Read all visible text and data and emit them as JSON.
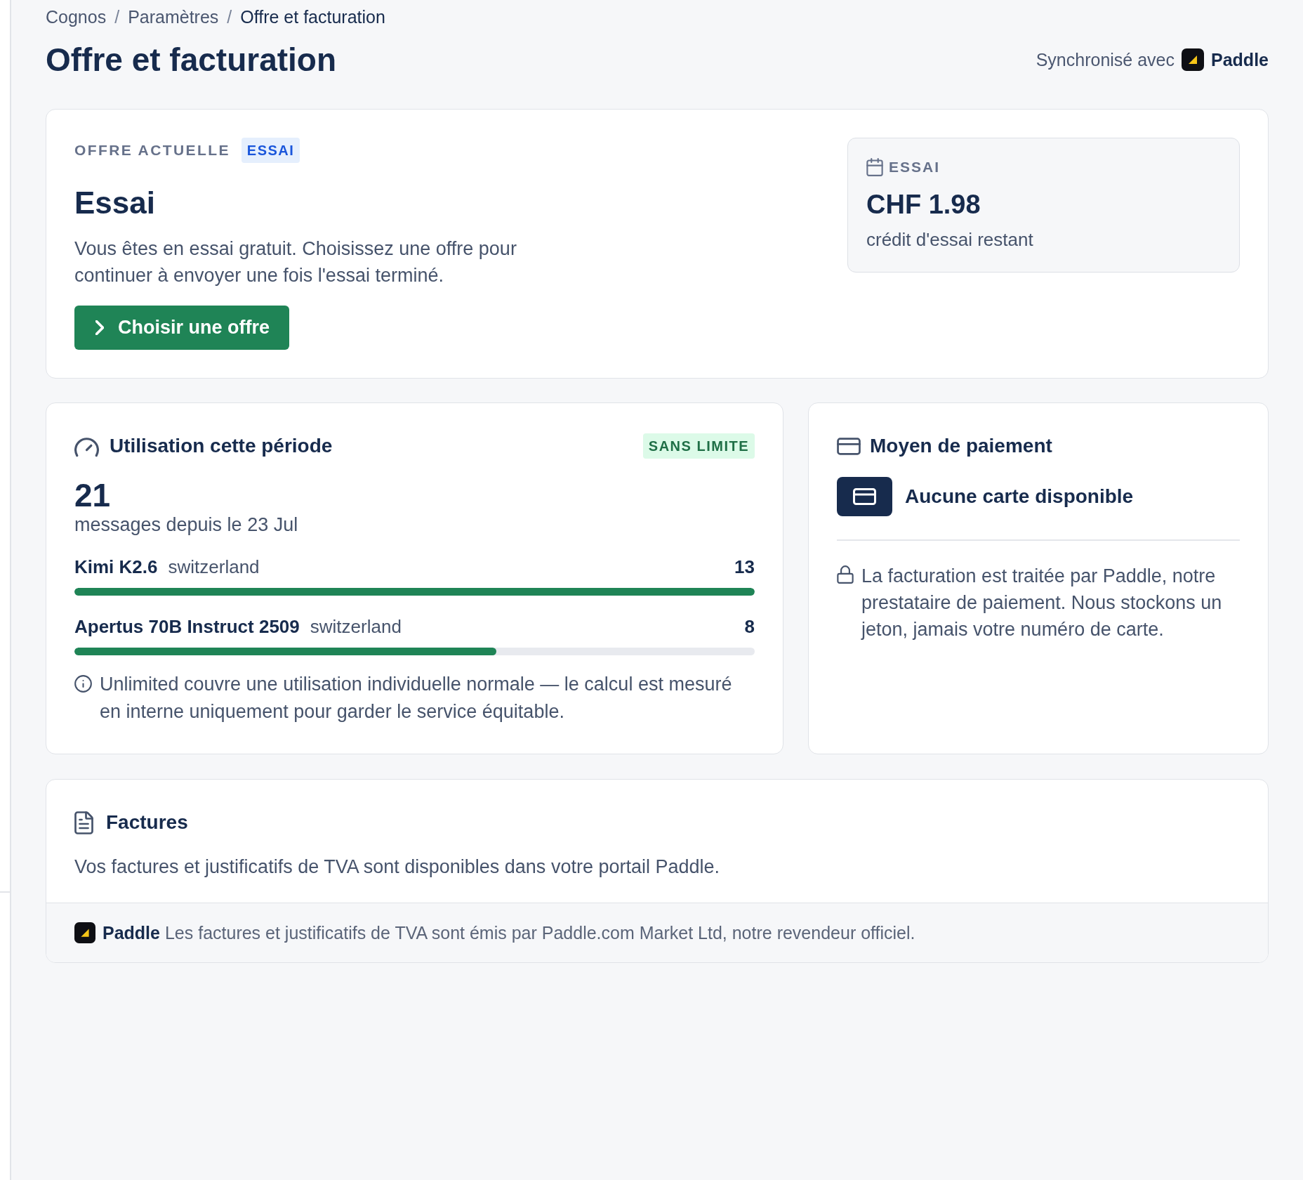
{
  "breadcrumb": {
    "items": [
      {
        "label": "Cognos",
        "current": false
      },
      {
        "label": "Paramètres",
        "current": false
      },
      {
        "label": "Offre et facturation",
        "current": true
      }
    ],
    "separators": [
      "/",
      "/"
    ]
  },
  "page_title": "Offre et facturation",
  "sync": {
    "label": "Synchronisé avec",
    "provider": "Paddle"
  },
  "current_offer": {
    "eyebrow": "OFFRE ACTUELLE",
    "badge": "ESSAI",
    "name": "Essai",
    "description": "Vous êtes en essai gratuit. Choisissez une offre pour continuer à envoyer une fois l'essai terminé.",
    "button": "Choisir une offre",
    "credit": {
      "label": "ESSAI",
      "amount": "CHF 1.98",
      "caption": "crédit d'essai restant"
    }
  },
  "usage": {
    "title": "Utilisation cette période",
    "badge": "SANS LIMITE",
    "count": "21",
    "caption": "messages depuis le 23 Jul",
    "models": [
      {
        "name": "Kimi K2.6",
        "region": "switzerland",
        "count": "13",
        "level": 1
      },
      {
        "name": "Apertus 70B Instruct 2509",
        "region": "switzerland",
        "count": "8",
        "level": 0.62
      }
    ],
    "note": "Unlimited couvre une utilisation individuelle normale — le calcul est mesuré en interne uniquement pour garder le service équitable."
  },
  "payment": {
    "title": "Moyen de paiement",
    "status": "Aucune carte disponible",
    "note": "La facturation est traitée par Paddle, notre prestataire de paiement. Nous stockons un jeton, jamais votre numéro de carte."
  },
  "invoices": {
    "title": "Factures",
    "text": "Vos factures et justificatifs de TVA sont disponibles dans votre portail Paddle.",
    "footer": "**Paddle** Les factures et justificatifs de TVA sont émis par Paddle.com Market Ltd, notre revendeur officiel."
  }
}
